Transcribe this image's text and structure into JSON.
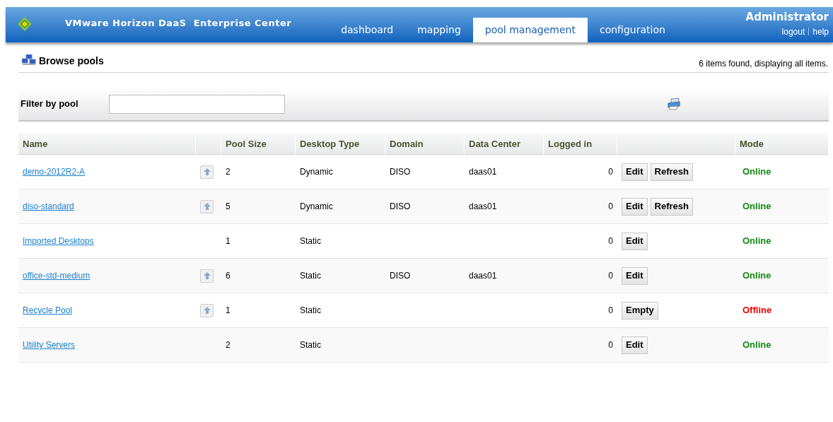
{
  "header": {
    "app_title": "VMware Horizon DaaS  Enterprise Center",
    "tabs": [
      {
        "label": "dashboard",
        "selected": false
      },
      {
        "label": "mapping",
        "selected": false
      },
      {
        "label": "pool management",
        "selected": true
      },
      {
        "label": "configuration",
        "selected": false
      }
    ],
    "user": "Administrator",
    "links": [
      "logout",
      "help"
    ]
  },
  "section": {
    "title": "Browse pools",
    "summary": "6 items found, displaying all items."
  },
  "filter": {
    "label": "Filter by pool"
  },
  "table": {
    "columns": [
      "Name",
      "Pool Size",
      "Desktop Type",
      "Domain",
      "Data Center",
      "Logged in",
      "Mode"
    ],
    "rows": [
      {
        "name": "demo-2012R2-A",
        "has_arrow": true,
        "pool_size": "2",
        "desktop_type": "Dynamic",
        "domain": "DISO",
        "data_center": "daas01",
        "logged_in": "0",
        "actions": [
          "Edit",
          "Refresh"
        ],
        "mode": "Online",
        "online": true
      },
      {
        "name": "diso-standard",
        "has_arrow": true,
        "pool_size": "5",
        "desktop_type": "Dynamic",
        "domain": "DISO",
        "data_center": "daas01",
        "logged_in": "0",
        "actions": [
          "Edit",
          "Refresh"
        ],
        "mode": "Online",
        "online": true
      },
      {
        "name": "Imported Desktops",
        "has_arrow": false,
        "pool_size": "1",
        "desktop_type": "Static",
        "logged_in": "0",
        "actions": [
          "Edit"
        ],
        "mode": "Online",
        "online": true
      },
      {
        "name": "office-std-medium",
        "has_arrow": true,
        "pool_size": "6",
        "desktop_type": "Static",
        "domain": "DISO",
        "data_center": "daas01",
        "logged_in": "0",
        "actions": [
          "Edit"
        ],
        "mode": "Online",
        "online": true
      },
      {
        "name": "Recycle Pool",
        "has_arrow": true,
        "pool_size": "1",
        "desktop_type": "Static",
        "logged_in": "0",
        "actions": [
          "Empty"
        ],
        "mode": "Offline",
        "online": false
      },
      {
        "name": "Utility Servers",
        "has_arrow": false,
        "pool_size": "2",
        "desktop_type": "Static",
        "logged_in": "0",
        "actions": [
          "Edit"
        ],
        "mode": "Online",
        "online": true
      }
    ]
  }
}
